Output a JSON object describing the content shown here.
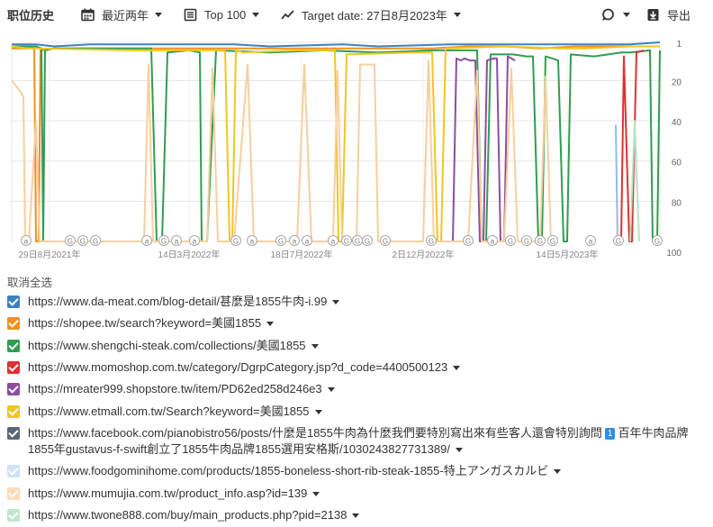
{
  "header": {
    "title": "职位历史",
    "period_label": "最近两年",
    "top_label": "Top 100",
    "target_label": "Target date: 27日8月2023年",
    "export_label": "导出"
  },
  "chart_data": {
    "type": "line",
    "y_axis": {
      "ticks": [
        "1",
        "20",
        "40",
        "60",
        "80",
        "100"
      ],
      "reversed": true,
      "range": [
        1,
        100
      ]
    },
    "x_axis": {
      "ticks": [
        "29日8月2021年",
        "14日3月2022年",
        "18日7月2022年",
        "2日12月2022年",
        "14日5月2023年"
      ]
    },
    "markers": [
      "a",
      "G",
      "G",
      "G",
      "a",
      "G",
      "a",
      "a",
      "G",
      "a",
      "G",
      "a",
      "a",
      "a",
      "G",
      "G",
      "G",
      "G",
      "G",
      "G",
      "a",
      "G",
      "G",
      "G",
      "G",
      "a",
      "G",
      "G"
    ],
    "series": [
      {
        "color": "#3b82c4",
        "points": [
          [
            13,
            2
          ],
          [
            40,
            2
          ],
          [
            60,
            3
          ],
          [
            100,
            2
          ],
          [
            180,
            2
          ],
          [
            200,
            2
          ],
          [
            260,
            2
          ],
          [
            300,
            3
          ],
          [
            380,
            2
          ],
          [
            420,
            3
          ],
          [
            500,
            2
          ],
          [
            560,
            2
          ],
          [
            600,
            2
          ],
          [
            640,
            2
          ],
          [
            700,
            2
          ],
          [
            733,
            1
          ]
        ]
      },
      {
        "color": "#f0901e",
        "points": [
          [
            13,
            4
          ],
          [
            30,
            4
          ],
          [
            38,
            3
          ],
          [
            40,
            100
          ],
          [
            43,
            100
          ],
          [
            45,
            5
          ],
          [
            60,
            4
          ],
          [
            120,
            4
          ],
          [
            200,
            4
          ],
          [
            260,
            4
          ],
          [
            300,
            4
          ],
          [
            400,
            4
          ],
          [
            480,
            4
          ],
          [
            520,
            3
          ],
          [
            560,
            3
          ],
          [
            600,
            4
          ],
          [
            640,
            3
          ],
          [
            700,
            3
          ],
          [
            733,
            3
          ]
        ]
      },
      {
        "color": "#2e9e4f",
        "points": [
          [
            13,
            3
          ],
          [
            40,
            3
          ],
          [
            46,
            4
          ],
          [
            48,
            100
          ],
          [
            50,
            5
          ],
          [
            60,
            4
          ],
          [
            150,
            4
          ],
          [
            168,
            4
          ],
          [
            174,
            100
          ],
          [
            180,
            100
          ],
          [
            186,
            6
          ],
          [
            210,
            5
          ],
          [
            222,
            6
          ],
          [
            224,
            100
          ],
          [
            230,
            100
          ],
          [
            240,
            5
          ],
          [
            300,
            6
          ],
          [
            360,
            5
          ],
          [
            420,
            6
          ],
          [
            480,
            5
          ],
          [
            520,
            5
          ],
          [
            530,
            5
          ],
          [
            535,
            100
          ],
          [
            540,
            100
          ],
          [
            545,
            7
          ],
          [
            570,
            7
          ],
          [
            585,
            8
          ],
          [
            592,
            8
          ],
          [
            598,
            100
          ],
          [
            602,
            100
          ],
          [
            606,
            8
          ],
          [
            620,
            10
          ],
          [
            626,
            100
          ],
          [
            630,
            100
          ],
          [
            634,
            7
          ],
          [
            660,
            8
          ],
          [
            690,
            6
          ],
          [
            700,
            6
          ],
          [
            722,
            5
          ],
          [
            725,
            100
          ],
          [
            730,
            100
          ],
          [
            733,
            5
          ]
        ]
      },
      {
        "color": "#e03030",
        "points": [
          [
            690,
            100
          ],
          [
            693,
            8
          ],
          [
            699,
            100
          ],
          [
            702,
            100
          ],
          [
            707,
            6
          ],
          [
            715,
            5
          ]
        ]
      },
      {
        "color": "#8b4ea0",
        "points": [
          [
            503,
            100
          ],
          [
            507,
            9
          ],
          [
            512,
            10
          ],
          [
            516,
            9
          ],
          [
            522,
            10
          ],
          [
            528,
            10
          ],
          [
            533,
            100
          ],
          [
            537,
            100
          ],
          [
            541,
            10
          ],
          [
            548,
            9
          ],
          [
            552,
            9
          ],
          [
            556,
            100
          ],
          [
            560,
            100
          ],
          [
            564,
            8
          ],
          [
            572,
            10
          ]
        ]
      },
      {
        "color": "#f1c522",
        "points": [
          [
            13,
            3
          ],
          [
            30,
            4
          ],
          [
            40,
            4
          ],
          [
            150,
            5
          ],
          [
            220,
            5
          ],
          [
            250,
            5
          ],
          [
            255,
            100
          ],
          [
            258,
            100
          ],
          [
            262,
            5
          ],
          [
            270,
            6
          ],
          [
            330,
            5
          ],
          [
            372,
            5
          ],
          [
            376,
            100
          ],
          [
            380,
            100
          ],
          [
            385,
            7
          ],
          [
            460,
            6
          ],
          [
            470,
            6
          ],
          [
            480,
            6
          ],
          [
            486,
            100
          ],
          [
            490,
            100
          ],
          [
            495,
            4
          ],
          [
            560,
            3
          ],
          [
            620,
            4
          ],
          [
            650,
            4
          ],
          [
            700,
            3
          ],
          [
            733,
            3
          ]
        ]
      },
      {
        "color": "#8fbce6",
        "points": [
          [
            684,
            42
          ],
          [
            686,
            100
          ]
        ]
      },
      {
        "color": "#f7cf9e",
        "points": [
          [
            13,
            20
          ],
          [
            22,
            25
          ],
          [
            26,
            28
          ],
          [
            28,
            100
          ],
          [
            32,
            100
          ],
          [
            40,
            40
          ],
          [
            44,
            100
          ],
          [
            160,
            100
          ],
          [
            165,
            12
          ],
          [
            170,
            100
          ],
          [
            230,
            100
          ],
          [
            236,
            14
          ],
          [
            242,
            100
          ],
          [
            260,
            100
          ],
          [
            275,
            12
          ],
          [
            282,
            100
          ],
          [
            330,
            100
          ],
          [
            338,
            12
          ],
          [
            346,
            100
          ],
          [
            370,
            100
          ],
          [
            375,
            15
          ],
          [
            380,
            100
          ],
          [
            396,
            100
          ],
          [
            400,
            12
          ],
          [
            416,
            12
          ],
          [
            420,
            100
          ],
          [
            470,
            100
          ],
          [
            476,
            10
          ],
          [
            482,
            100
          ],
          [
            520,
            100
          ],
          [
            530,
            15
          ],
          [
            535,
            100
          ],
          [
            560,
            100
          ],
          [
            568,
            14
          ],
          [
            575,
            100
          ],
          [
            600,
            100
          ],
          [
            606,
            18
          ],
          [
            612,
            100
          ]
        ]
      },
      {
        "color": "#b8e4c6",
        "points": [
          [
            700,
            100
          ],
          [
            705,
            40
          ],
          [
            710,
            100
          ]
        ]
      }
    ]
  },
  "deselect_label": "取消全选",
  "rows": [
    {
      "color": "#3b82c4",
      "url": "https://www.da-meat.com/blog-detail/甚麼是1855牛肉-i.99"
    },
    {
      "color": "#f0901e",
      "url": "https://shopee.tw/search?keyword=美國1855"
    },
    {
      "color": "#2e9e4f",
      "url": "https://www.shengchi-steak.com/collections/美國1855"
    },
    {
      "color": "#e03030",
      "url": "https://www.momoshop.com.tw/category/DgrpCategory.jsp?d_code=4400500123"
    },
    {
      "color": "#8b4ea0",
      "url": "https://mreater999.shopstore.tw/item/PD62ed258d246e3"
    },
    {
      "color": "#f1c522",
      "url": "https://www.etmall.com.tw/Search?keyword=美國1855"
    },
    {
      "color": "#5b6777",
      "url_a": "https://www.facebook.com/pianobistro56/posts/什麼是1855牛肉為什麼我們要特別寫出來有些客人還會特別詢問",
      "badge": "1",
      "url_b": "百年牛肉品牌1855年gustavus-f-swift創立了1855牛肉品牌1855選用安格斯/1030243827731389/"
    },
    {
      "color": "#cfe2f5",
      "url": "https://www.foodgominihome.com/products/1855-boneless-short-rib-steak-1855-特上アンガスカルビ"
    },
    {
      "color": "#fbdcb8",
      "url": "https://www.mumujia.com.tw/product_info.asp?id=139"
    },
    {
      "color": "#bfe6cc",
      "url": "https://www.twone888.com/buy/main_products.php?pid=2138"
    }
  ]
}
